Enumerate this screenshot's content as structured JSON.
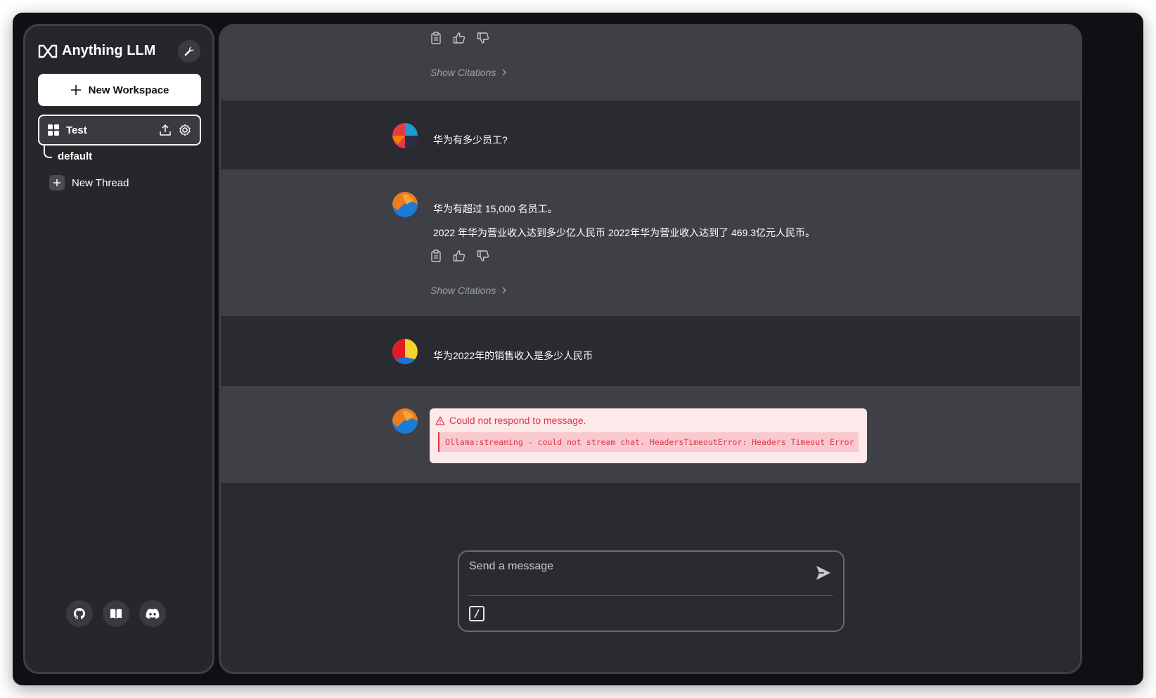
{
  "app": {
    "title": "Anything LLM"
  },
  "sidebar": {
    "new_workspace_label": "New Workspace",
    "workspace": {
      "name": "Test"
    },
    "threads": [
      {
        "label": "default"
      }
    ],
    "new_thread_label": "New Thread",
    "footer_icons": [
      "github-icon",
      "docs-book-icon",
      "discord-icon"
    ]
  },
  "chat": {
    "messages": [
      {
        "role": "assistant",
        "text": "",
        "actions": [
          "copy-icon",
          "thumbs-up-icon",
          "thumbs-down-icon"
        ],
        "citations_label": "Show Citations"
      },
      {
        "role": "user",
        "text": "华为有多少员工?"
      },
      {
        "role": "assistant",
        "lines": [
          "华为有超过 15,000 名员工。",
          "2022 年华为营业收入达到多少亿人民币 2022年华为营业收入达到了 469.3亿元人民币。"
        ],
        "citations_label": "Show Citations"
      },
      {
        "role": "user",
        "text": "华为2022年的销售收入是多少人民币"
      },
      {
        "role": "assistant",
        "error": {
          "title": "Could not respond to message.",
          "detail": "Ollama:streaming - could not stream chat. HeadersTimeoutError: Headers Timeout Error"
        }
      }
    ]
  },
  "composer": {
    "placeholder": "Send a message",
    "value": ""
  },
  "colors": {
    "accent_error": "#e0354b",
    "sidebar_bg": "#26272b",
    "main_bg": "#2a2b30",
    "ai_row_bg": "#3f4046"
  }
}
